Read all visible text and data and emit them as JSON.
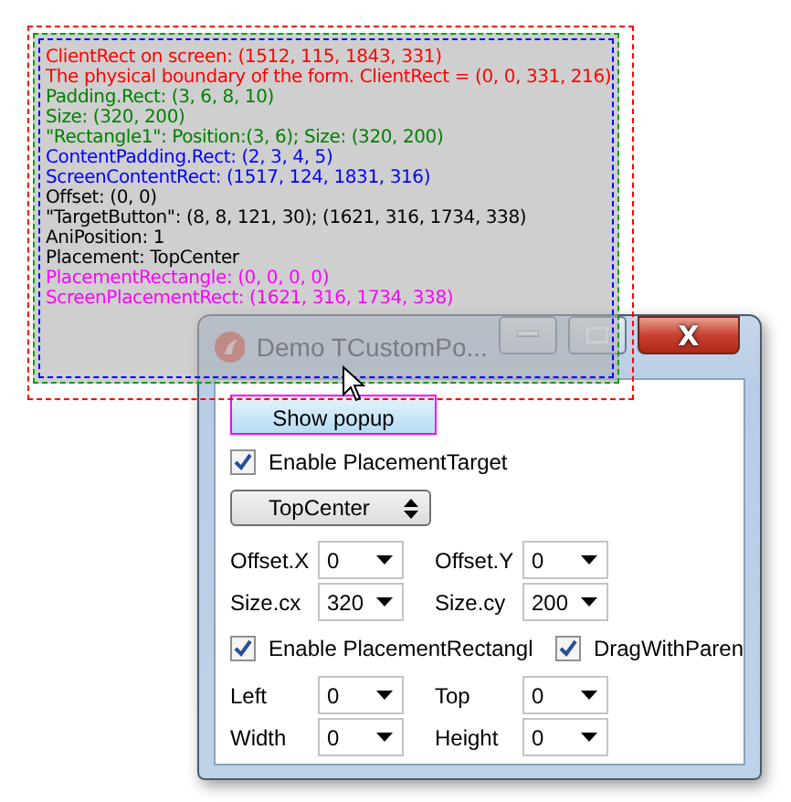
{
  "popup": {
    "lines": [
      {
        "text": "ClientRect on screen: (1512, 115, 1843, 331)",
        "color": "#ff0000"
      },
      {
        "text": "The physical boundary of the form. ClientRect = (0, 0, 331, 216)",
        "color": "#ff0000"
      },
      {
        "text": "Padding.Rect: (3, 6, 8, 10)",
        "color": "#008000"
      },
      {
        "text": "Size: (320, 200)",
        "color": "#008000"
      },
      {
        "text": "\"Rectangle1\": Position:(3, 6); Size: (320, 200)",
        "color": "#008000"
      },
      {
        "text": "ContentPadding.Rect: (2, 3, 4, 5)",
        "color": "#0000ff"
      },
      {
        "text": "ScreenContentRect: (1517, 124, 1831, 316)",
        "color": "#0000ff"
      },
      {
        "text": "Offset: (0, 0)",
        "color": "#000000"
      },
      {
        "text": "\"TargetButton\": (8, 8, 121, 30); (1621, 316, 1734, 338)",
        "color": "#000000"
      },
      {
        "text": "AniPosition: 1",
        "color": "#000000"
      },
      {
        "text": "Placement: TopCenter",
        "color": "#000000"
      },
      {
        "text": "PlacementRectangle: (0, 0, 0, 0)",
        "color": "#ff00ff"
      },
      {
        "text": "ScreenPlacementRect: (1621, 316, 1734, 338)",
        "color": "#ff00ff"
      }
    ]
  },
  "window": {
    "title": "Demo TCustomPo...",
    "close": "X",
    "show_button": "Show popup",
    "enable_target": {
      "label": "Enable PlacementTarget",
      "checked": true
    },
    "placement": "TopCenter",
    "offset_fields": [
      {
        "label": "Offset.X",
        "value": "0"
      },
      {
        "label": "Offset.Y",
        "value": "0"
      },
      {
        "label": "Size.cx",
        "value": "320"
      },
      {
        "label": "Size.cy",
        "value": "200"
      }
    ],
    "checkboxes": [
      {
        "label": "Enable PlacementRectangl",
        "checked": true
      },
      {
        "label": "DragWithParen",
        "checked": true
      }
    ],
    "rect_fields": [
      {
        "label": "Left",
        "value": "0"
      },
      {
        "label": "Top",
        "value": "0"
      },
      {
        "label": "Width",
        "value": "0"
      },
      {
        "label": "Height",
        "value": "0"
      }
    ]
  }
}
